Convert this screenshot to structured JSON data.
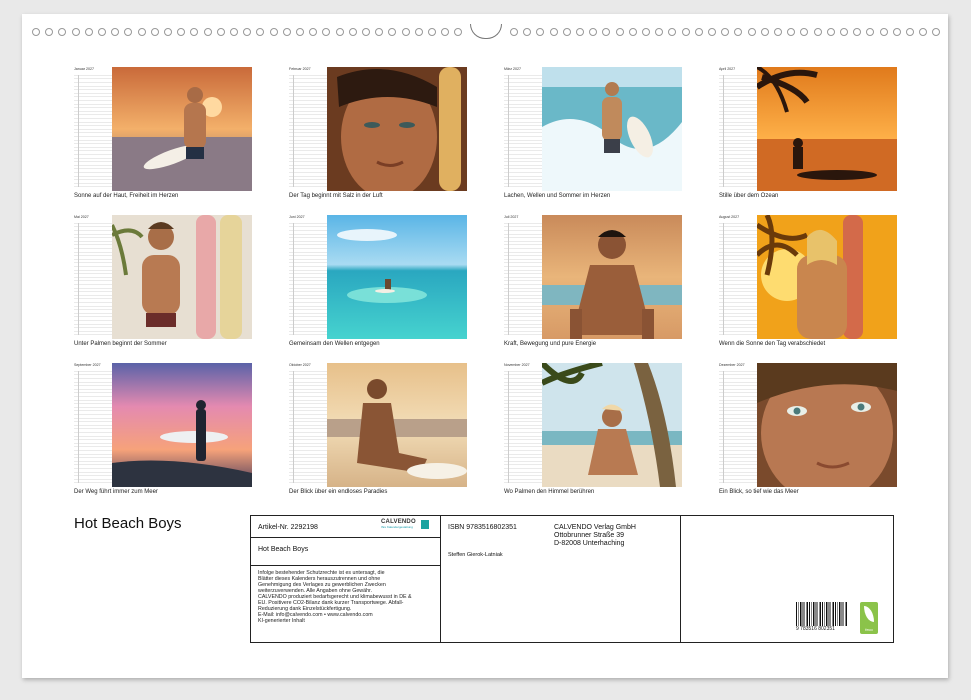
{
  "title": "Hot Beach Boys",
  "months": [
    {
      "label": "Januar 2027",
      "caption": "Sonne auf der Haut, Freiheit im Herzen",
      "scene": "sunset-surfer"
    },
    {
      "label": "Februar 2027",
      "caption": "Der Tag beginnt mit Salz in der Luft",
      "scene": "closeup-face"
    },
    {
      "label": "März 2027",
      "caption": "Lachen, Wellen und Sommer im Herzen",
      "scene": "wave-runner"
    },
    {
      "label": "April 2027",
      "caption": "Stille über dem Ozean",
      "scene": "sunset-palm"
    },
    {
      "label": "Mai 2027",
      "caption": "Unter Palmen beginnt der Sommer",
      "scene": "boards-palm"
    },
    {
      "label": "Juni 2027",
      "caption": "Gemeinsam den Wellen entgegen",
      "scene": "turquoise-sea"
    },
    {
      "label": "Juli 2027",
      "caption": "Kraft, Bewegung und pure Energie",
      "scene": "beach-pose"
    },
    {
      "label": "August 2027",
      "caption": "Wenn die Sonne den Tag verabschiedet",
      "scene": "golden-palm"
    },
    {
      "label": "September 2027",
      "caption": "Der Weg führt immer zum Meer",
      "scene": "pink-sunset"
    },
    {
      "label": "Oktober 2027",
      "caption": "Der Blick über ein endloses Paradies",
      "scene": "sitting-sand"
    },
    {
      "label": "November 2027",
      "caption": "Wo Palmen den Himmel berühren",
      "scene": "palm-sitting"
    },
    {
      "label": "Dezember 2027",
      "caption": "Ein Blick, so tief wie das Meer",
      "scene": "closeup-eyes"
    }
  ],
  "info_box": {
    "article": "Artikel-Nr. 2292198",
    "book_title": "Hot Beach Boys",
    "publisher_logo": "CALVENDO",
    "publisher_logo_sub": "Ihre Kalendergestaltung",
    "isbn": "ISBN 9783516802351",
    "author": "Steffen Gierok-Latniak",
    "publisher_name": "CALVENDO Verlag GmbH",
    "publisher_street": "Ottobrunner Straße 39",
    "publisher_city": "D-82008 Unterhaching",
    "legal_lines": [
      "Infolge bestehender Schutzrechte ist es untersagt, die",
      "Blätter dieses Kalenders herauszutrennen und ohne",
      "Genehmigung des Verlages zu gewerblichen Zwecken",
      "weiterzuverwenden. Alle Angaben ohne Gewähr.",
      "CALVENDO produziert bedarfsgerecht und klimabewusst in DE &",
      "EU. Positivere CO2-Bilanz dank kurzer Transportwege. Abfall-",
      "Reduzierung dank Einzelstückfertigung.",
      "E-Mail: info@calvendo.com • www.calvendo.com",
      "KI-generierter Inhalt"
    ],
    "barcode_number": "9 783516 802351",
    "eco_label": "feco"
  }
}
